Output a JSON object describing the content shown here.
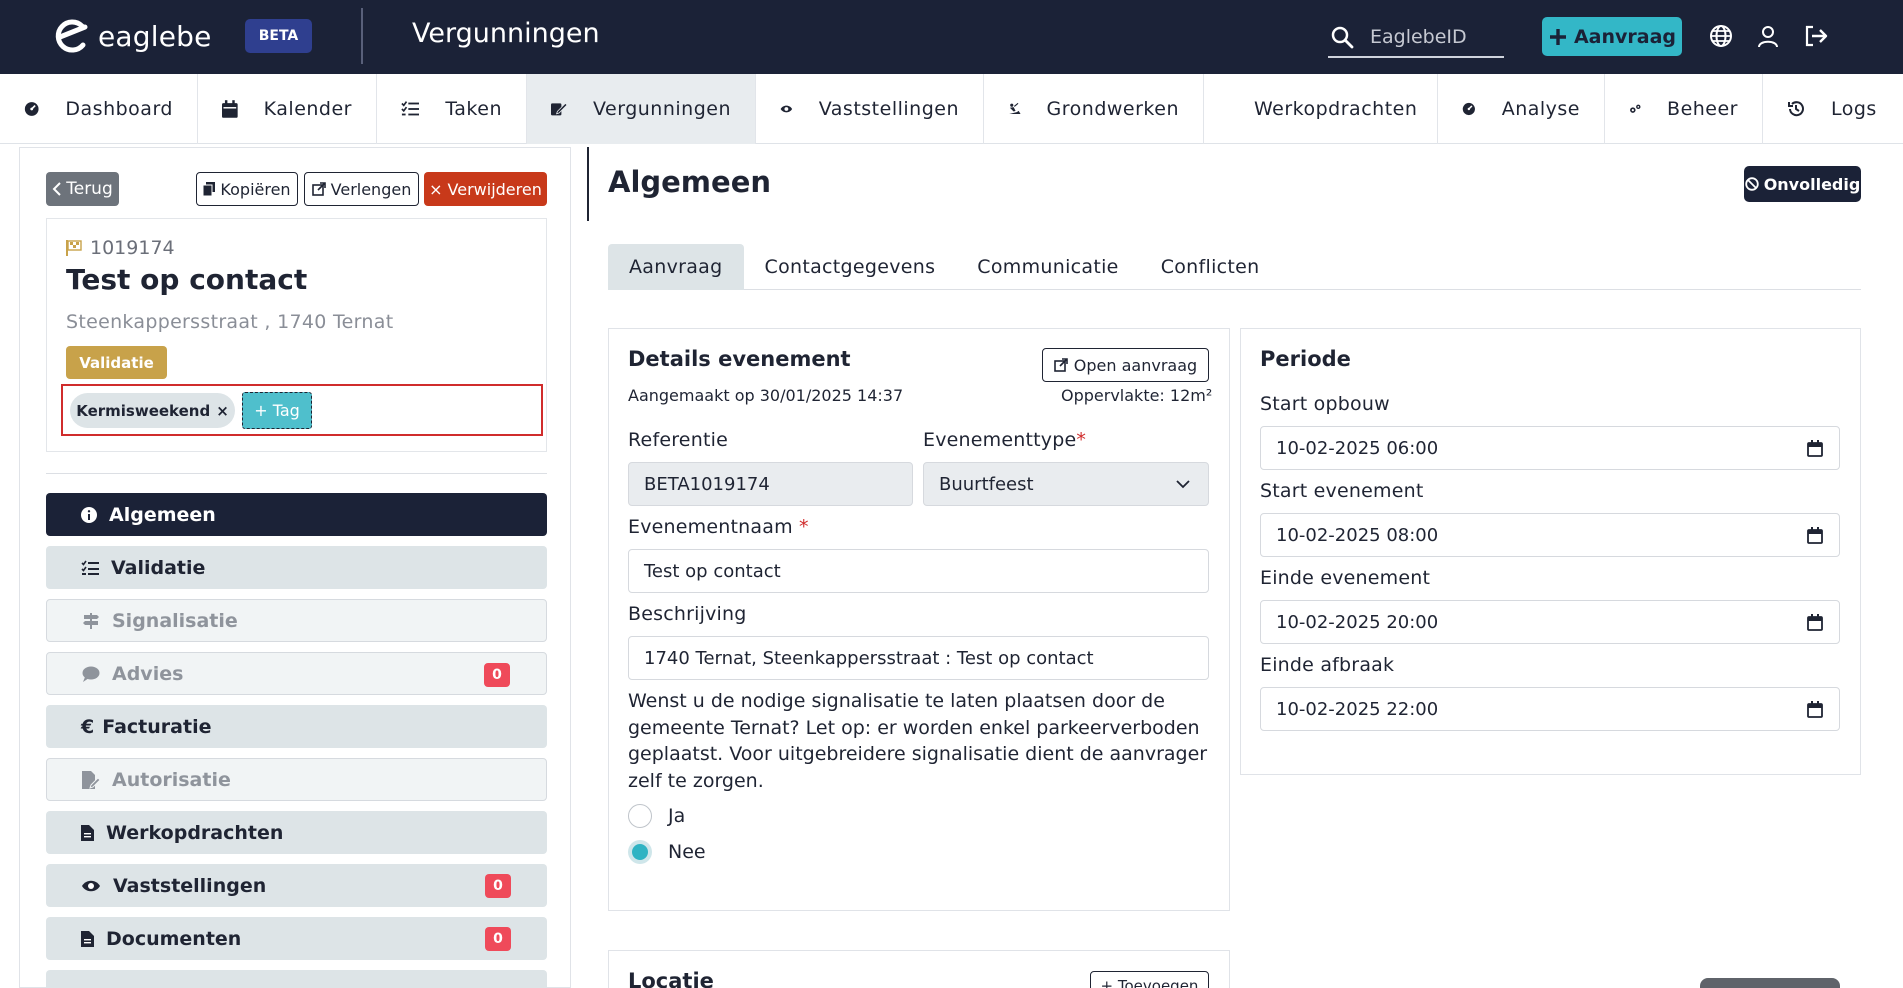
{
  "topbar": {
    "logo_text": "eaglebe",
    "beta_label": "BETA",
    "app_title": "Vergunningen",
    "search_placeholder": "EaglebeID",
    "aanvraag_label": "Aanvraag"
  },
  "nav": {
    "items": [
      {
        "label": "Dashboard",
        "icon": "dashboard-gauge-icon"
      },
      {
        "label": "Kalender",
        "icon": "calendar-icon"
      },
      {
        "label": "Taken",
        "icon": "task-list-icon"
      },
      {
        "label": "Vergunningen",
        "icon": "permit-edit-icon"
      },
      {
        "label": "Vaststellingen",
        "icon": "eye-icon"
      },
      {
        "label": "Grondwerken",
        "icon": "digging-icon"
      },
      {
        "label": "Werkopdrachten",
        "icon": "document-icon"
      },
      {
        "label": "Analyse",
        "icon": "analysis-gauge-icon"
      },
      {
        "label": "Beheer",
        "icon": "cogs-icon"
      },
      {
        "label": "Logs",
        "icon": "history-icon"
      }
    ],
    "active": "Vergunningen"
  },
  "left": {
    "back_label": "Terug",
    "copy_label": "Kopiëren",
    "extend_label": "Verlengen",
    "delete_label": "Verwijderen",
    "dossier_id": "1019174",
    "title": "Test op contact",
    "address": "Steenkappersstraat , 1740 Ternat",
    "status": "Validatie",
    "tag": "Kermisweekend",
    "tag_remove": "×",
    "add_tag": "+ Tag",
    "menu": [
      {
        "label": "Algemeen",
        "state": "active"
      },
      {
        "label": "Validatie",
        "state": "normal"
      },
      {
        "label": "Signalisatie",
        "state": "disabled"
      },
      {
        "label": "Advies",
        "state": "disabled",
        "count": "0"
      },
      {
        "label": "Facturatie",
        "state": "normal"
      },
      {
        "label": "Autorisatie",
        "state": "disabled"
      },
      {
        "label": "Werkopdrachten",
        "state": "normal"
      },
      {
        "label": "Vaststellingen",
        "state": "normal",
        "count": "0"
      },
      {
        "label": "Documenten",
        "state": "normal",
        "count": "0"
      }
    ]
  },
  "main": {
    "title": "Algemeen",
    "status_pill": "Onvolledig",
    "tabs": [
      "Aanvraag",
      "Contactgegevens",
      "Communicatie",
      "Conflicten"
    ],
    "active_tab": "Aanvraag",
    "details": {
      "title": "Details evenement",
      "open_label": "Open aanvraag",
      "created": "Aangemaakt op 30/01/2025 14:37",
      "area": "Oppervlakte: 12m²",
      "ref_label": "Referentie",
      "ref_value": "BETA1019174",
      "type_label": "Evenementtype",
      "type_value": "Buurtfeest",
      "name_label": "Evenementnaam",
      "name_value": "Test op contact",
      "desc_label": "Beschrijving",
      "desc_value": "1740 Ternat, Steenkappersstraat : Test op contact",
      "question": "Wenst u de nodige signalisatie te laten plaatsen door de gemeente Ternat? Let op: er worden enkel parkeerverboden geplaatst. Voor uitgebreidere signalisatie dient de aanvrager zelf te zorgen.",
      "option_yes": "Ja",
      "option_no": "Nee",
      "selected": "Nee"
    },
    "periode": {
      "title": "Periode",
      "start_build_label": "Start opbouw",
      "start_build": "10-02-2025 06:00",
      "start_event_label": "Start evenement",
      "start_event": "10-02-2025 08:00",
      "end_event_label": "Einde evenement",
      "end_event": "10-02-2025 20:00",
      "end_break_label": "Einde afbraak",
      "end_break": "10-02-2025 22:00"
    },
    "locatie": {
      "title": "Locatie",
      "add_label": "+ Toevoegen"
    }
  },
  "colors": {
    "topbar": "#1b2237",
    "accent": "#33b7c7",
    "danger": "#c8391a",
    "badge": "#c8a24a",
    "count": "#ef4a5a"
  }
}
